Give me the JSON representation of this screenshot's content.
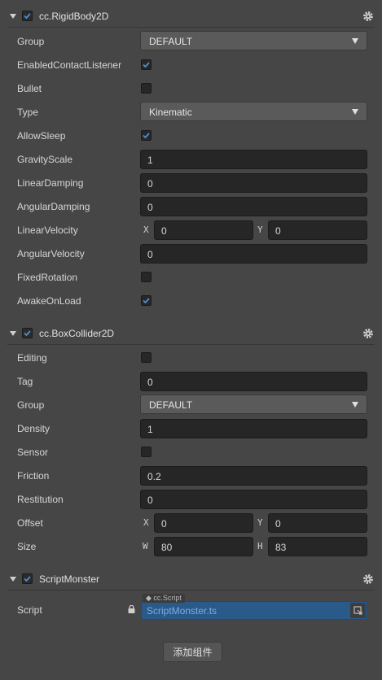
{
  "rigidbody": {
    "title": "cc.RigidBody2D",
    "enabled": true,
    "group_label": "Group",
    "group_value": "DEFAULT",
    "contact_label": "EnabledContactListener",
    "contact_checked": true,
    "bullet_label": "Bullet",
    "bullet_checked": false,
    "type_label": "Type",
    "type_value": "Kinematic",
    "sleep_label": "AllowSleep",
    "sleep_checked": true,
    "gravity_label": "GravityScale",
    "gravity_value": "1",
    "lineardamp_label": "LinearDamping",
    "lineardamp_value": "0",
    "angulardamp_label": "AngularDamping",
    "angulardamp_value": "0",
    "linvel_label": "LinearVelocity",
    "linvel_x_axis": "X",
    "linvel_x": "0",
    "linvel_y_axis": "Y",
    "linvel_y": "0",
    "angvel_label": "AngularVelocity",
    "angvel_value": "0",
    "fixedrot_label": "FixedRotation",
    "fixedrot_checked": false,
    "awake_label": "AwakeOnLoad",
    "awake_checked": true
  },
  "boxcollider": {
    "title": "cc.BoxCollider2D",
    "enabled": true,
    "editing_label": "Editing",
    "editing_checked": false,
    "tag_label": "Tag",
    "tag_value": "0",
    "group_label": "Group",
    "group_value": "DEFAULT",
    "density_label": "Density",
    "density_value": "1",
    "sensor_label": "Sensor",
    "sensor_checked": false,
    "friction_label": "Friction",
    "friction_value": "0.2",
    "restitution_label": "Restitution",
    "restitution_value": "0",
    "offset_label": "Offset",
    "offset_x_axis": "X",
    "offset_x": "0",
    "offset_y_axis": "Y",
    "offset_y": "0",
    "size_label": "Size",
    "size_w_axis": "W",
    "size_w": "80",
    "size_h_axis": "H",
    "size_h": "83"
  },
  "scriptmonster": {
    "title": "ScriptMonster",
    "enabled": true,
    "script_label": "Script",
    "script_tag": "cc.Script",
    "script_value": "ScriptMonster.ts"
  },
  "add_component_label": "添加组件",
  "colors": {
    "check": "#4d8fd6",
    "script_bg": "#2a5a8a",
    "panel_bg": "#464646"
  },
  "icons": {
    "gear": "gear-icon",
    "lock": "lock-icon",
    "caret": "chevron-down-icon",
    "check": "check-icon"
  }
}
